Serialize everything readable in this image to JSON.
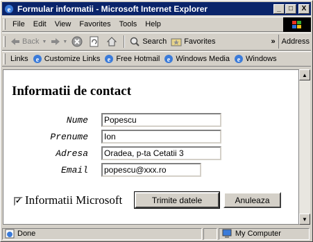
{
  "window": {
    "title": "Formular informatii - Microsoft Internet Explorer",
    "minimize": "_",
    "maximize": "□",
    "close": "X"
  },
  "menu": [
    "File",
    "Edit",
    "View",
    "Favorites",
    "Tools",
    "Help"
  ],
  "toolbar": {
    "back": "Back",
    "search": "Search",
    "favorites": "Favorites",
    "chevron": "»",
    "address": "Address"
  },
  "links": {
    "label": "Links",
    "items": [
      "Customize Links",
      "Free Hotmail",
      "Windows Media",
      "Windows"
    ]
  },
  "page": {
    "heading": "Informatii de contact",
    "fields": {
      "nume": {
        "label": "Nume",
        "value": "Popescu"
      },
      "prenume": {
        "label": "Prenume",
        "value": "Ion"
      },
      "adresa": {
        "label": "Adresa",
        "value": "Oradea, p-ta Cetatii 3"
      },
      "email": {
        "label": "Email",
        "value": "popescu@xxx.ro"
      }
    },
    "checkbox": {
      "label": "Informatii Microsoft",
      "checked": true,
      "mark": "✓"
    },
    "submit": "Trimite datele",
    "reset": "Anuleaza"
  },
  "status": {
    "text": "Done",
    "zone": "My Computer"
  },
  "icons": [
    "ie-icon",
    "back-arrow-icon",
    "forward-arrow-icon",
    "stop-icon",
    "refresh-icon",
    "home-icon",
    "search-icon",
    "favorites-icon",
    "link-page-icon",
    "computer-icon",
    "windows-logo-icon"
  ]
}
